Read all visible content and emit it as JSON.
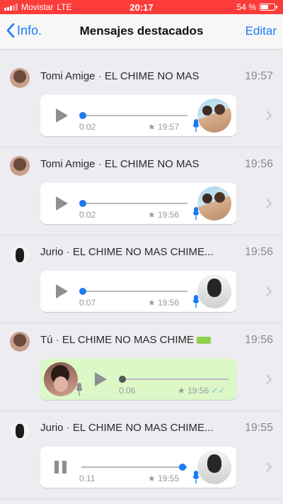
{
  "status": {
    "carrier": "Movistar",
    "network": "LTE",
    "time": "20:17",
    "battery": "54 %"
  },
  "nav": {
    "back_label": "Info.",
    "title": "Mensajes destacados",
    "edit_label": "Editar"
  },
  "colors": {
    "status_bar": "#fb3c3a",
    "accent": "#1a7cf5",
    "outgoing_bubble": "#dcf8c6"
  },
  "messages": [
    {
      "sender": "Tomi Amige",
      "chat": "EL CHIME NO MAS",
      "time": "19:57",
      "duration": "0:02",
      "stamp": "19:57",
      "state": "play",
      "progress": 0.0
    },
    {
      "sender": "Tomi Amige",
      "chat": "EL CHIME NO MAS",
      "time": "19:56",
      "duration": "0:02",
      "stamp": "19:56",
      "state": "play",
      "progress": 0.0
    },
    {
      "sender": "Jurio",
      "chat": "EL CHIME NO MAS CHIME...",
      "time": "19:56",
      "duration": "0:07",
      "stamp": "19:56",
      "state": "play",
      "progress": 0.0
    },
    {
      "sender": "Tú",
      "chat": "EL CHIME NO MAS CHIME",
      "time": "19:56",
      "duration": "0:06",
      "stamp": "19:56",
      "state": "play",
      "progress": 0.0
    },
    {
      "sender": "Jurio",
      "chat": "EL CHIME NO MAS CHIME...",
      "time": "19:55",
      "duration": "0:11",
      "stamp": "19:55",
      "state": "pause",
      "progress": 1.0
    }
  ]
}
